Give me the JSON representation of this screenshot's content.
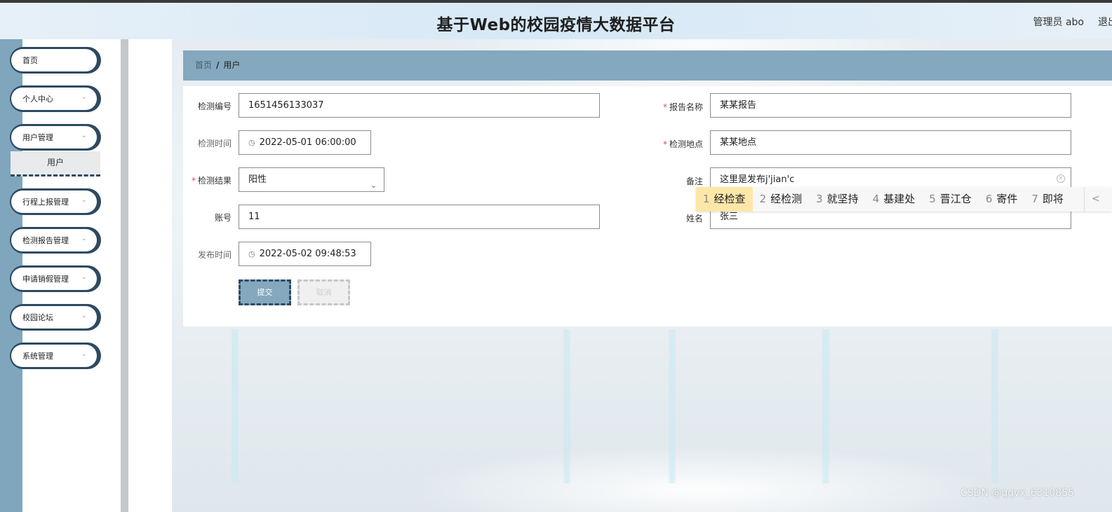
{
  "header": {
    "title": "基于Web的校园疫情大数据平台",
    "user": "管理员 abo",
    "logout": "退出"
  },
  "sidebar": {
    "items": [
      {
        "label": "首页"
      },
      {
        "label": "个人中心"
      },
      {
        "label": "用户管理"
      },
      {
        "label": "行程上报管理"
      },
      {
        "label": "检测报告管理"
      },
      {
        "label": "申请销假管理"
      },
      {
        "label": "校园论坛"
      },
      {
        "label": "系统管理"
      }
    ],
    "submenu": {
      "label": "用户"
    },
    "chevron": "chevron-down-icon"
  },
  "breadcrumb": {
    "home": "首页",
    "separator": "/",
    "current": "用户"
  },
  "form": {
    "test_no": {
      "label": "检测编号",
      "value": "1651456133037"
    },
    "test_time": {
      "label": "检测时间",
      "value": "2022-05-01 06:00:00"
    },
    "test_result": {
      "label": "检测结果",
      "value": "阳性"
    },
    "account": {
      "label": "账号",
      "value": "11"
    },
    "publish_time": {
      "label": "发布时间",
      "value": "2022-05-02 09:48:53"
    },
    "report_name": {
      "label": "报告名称",
      "value": "某某报告"
    },
    "test_location": {
      "label": "检测地点",
      "value": "某某地点"
    },
    "remarks": {
      "label": "备注",
      "value": "这里是发布j'jian'c"
    },
    "name": {
      "label": "姓名",
      "value": "张三"
    },
    "required_mark": "*",
    "submit_label": "提交",
    "cancel_label": "取消"
  },
  "ime": {
    "candidates": [
      {
        "num": "1",
        "text": "经检查"
      },
      {
        "num": "2",
        "text": "经检测"
      },
      {
        "num": "3",
        "text": "就坚持"
      },
      {
        "num": "4",
        "text": "基建处"
      },
      {
        "num": "5",
        "text": "晋江仓"
      },
      {
        "num": "6",
        "text": "寄件"
      },
      {
        "num": "7",
        "text": "即将"
      }
    ],
    "prev": "<"
  },
  "watermark": "CSDN @qqvx_6310855",
  "colors": {
    "accent": "#84a8be",
    "dark": "#2d4a61",
    "required": "#e04a4a"
  }
}
